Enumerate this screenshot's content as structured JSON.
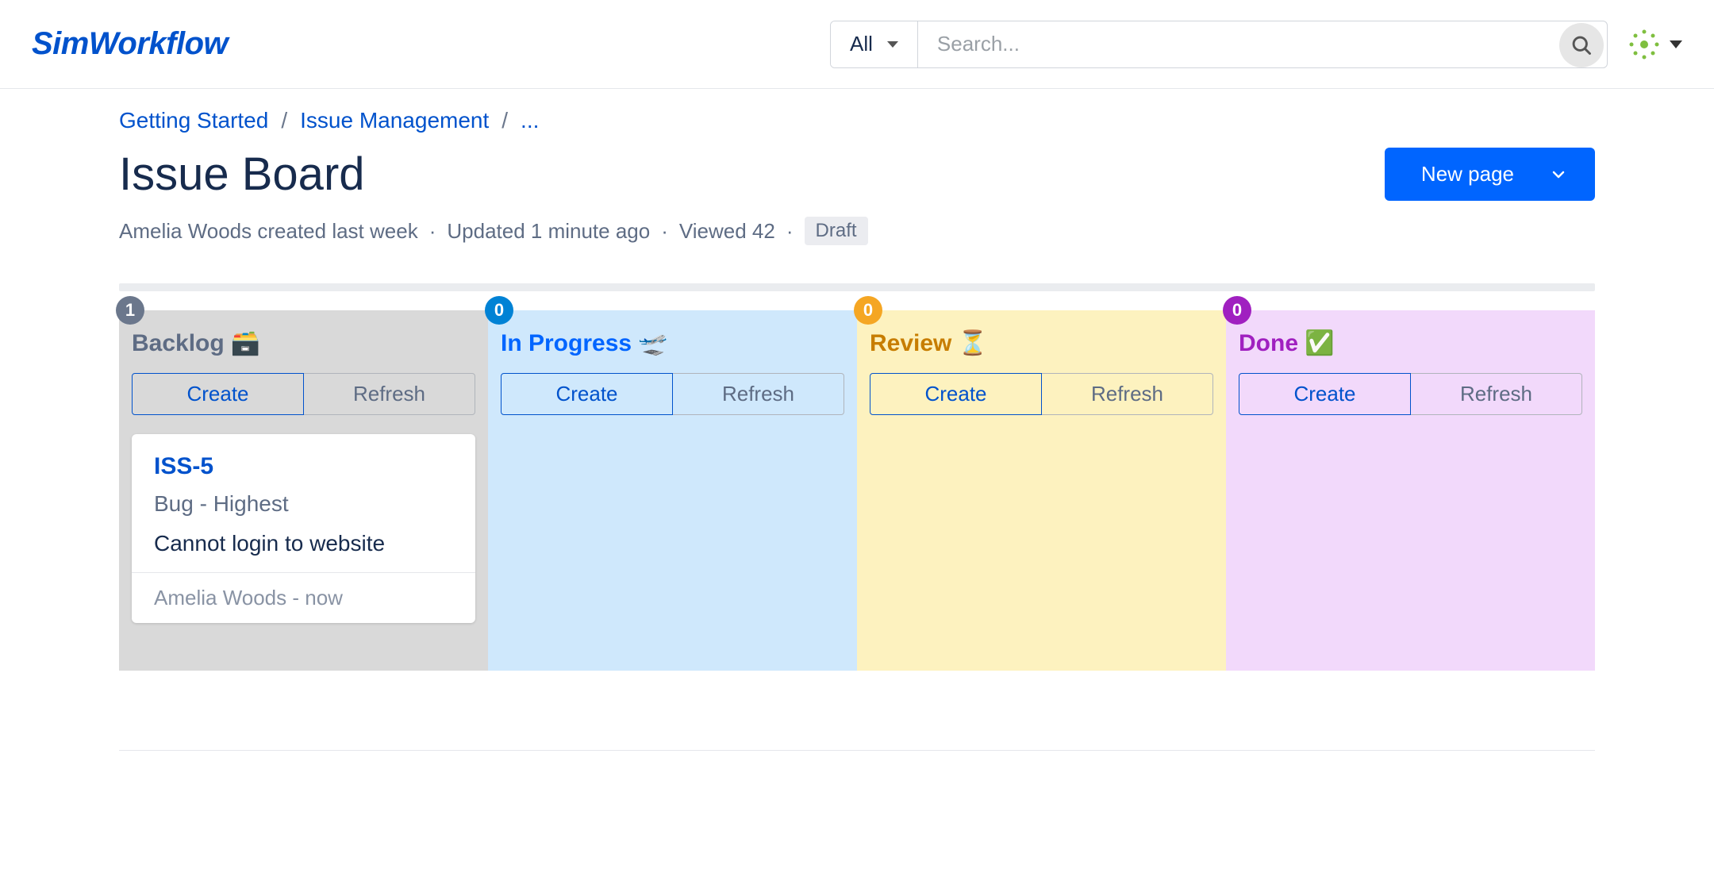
{
  "header": {
    "logo": "SimWorkflow",
    "search_filter": "All",
    "search_placeholder": "Search..."
  },
  "breadcrumb": {
    "items": [
      "Getting Started",
      "Issue Management",
      "..."
    ]
  },
  "page": {
    "title": "Issue Board",
    "new_page_label": "New page",
    "meta_author_line": "Amelia Woods created last week",
    "meta_updated": "Updated 1 minute ago",
    "meta_viewed": "Viewed 42",
    "draft_label": "Draft"
  },
  "board": {
    "create_label": "Create",
    "refresh_label": "Refresh",
    "columns": [
      {
        "key": "backlog",
        "title": "Backlog",
        "emoji": "🗃️",
        "count": "1",
        "badge_class": "grey",
        "title_class": "grey"
      },
      {
        "key": "inprogress",
        "title": "In Progress",
        "emoji": "🛫",
        "count": "0",
        "badge_class": "blue",
        "title_class": "blue"
      },
      {
        "key": "review",
        "title": "Review",
        "emoji": "⏳",
        "count": "0",
        "badge_class": "orange",
        "title_class": "orange"
      },
      {
        "key": "done",
        "title": "Done",
        "emoji": "✅",
        "count": "0",
        "badge_class": "purple",
        "title_class": "purple"
      }
    ],
    "cards": {
      "backlog": [
        {
          "id": "ISS-5",
          "type": "Bug - Highest",
          "summary": "Cannot login to website",
          "footer": "Amelia Woods - now"
        }
      ]
    }
  }
}
